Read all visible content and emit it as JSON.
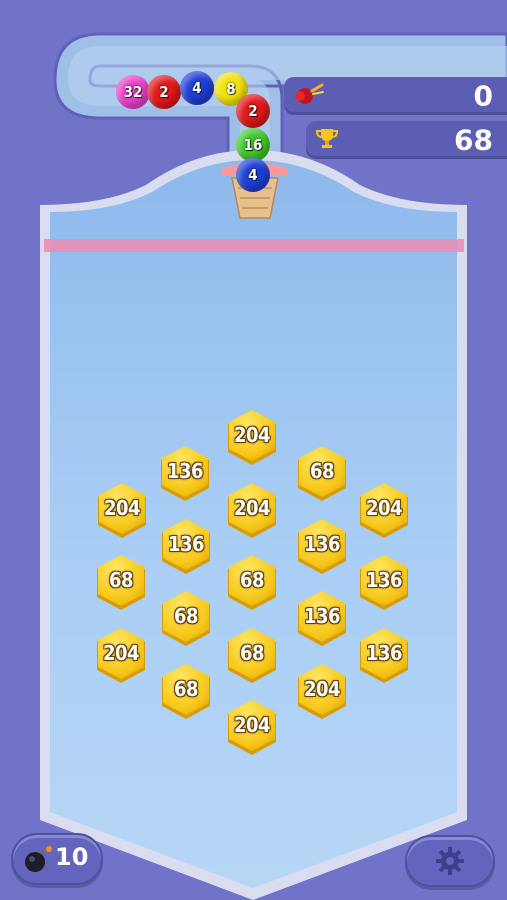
{
  "colors": {
    "background": "#7173c9",
    "board_fill": "#9fc7f4",
    "board_rim": "#d9ddef",
    "deadline": "#e88fb2",
    "hex_gold": "#f5c518",
    "panel": "#5b5eb2"
  },
  "hud": {
    "shots": {
      "icon": "cannon-icon",
      "value": "0"
    },
    "best": {
      "icon": "trophy-icon",
      "value": "68"
    }
  },
  "queue_balls": [
    {
      "label": "32",
      "color": "#e93fc9"
    },
    {
      "label": "2",
      "color": "#e01818"
    },
    {
      "label": "4",
      "color": "#1f3fd6"
    },
    {
      "label": "8",
      "color": "#f2e20a"
    },
    {
      "label": "2",
      "color": "#e01818"
    },
    {
      "label": "16",
      "color": "#3ec92c"
    }
  ],
  "current_ball": {
    "label": "4",
    "color": "#1f3fd6"
  },
  "hexes": [
    {
      "id": "hex-1",
      "label": "204"
    },
    {
      "id": "hex-2",
      "label": "136"
    },
    {
      "id": "hex-3",
      "label": "68"
    },
    {
      "id": "hex-4",
      "label": "204"
    },
    {
      "id": "hex-5",
      "label": "204"
    },
    {
      "id": "hex-6",
      "label": "204"
    },
    {
      "id": "hex-7",
      "label": "136"
    },
    {
      "id": "hex-8",
      "label": "136"
    },
    {
      "id": "hex-9",
      "label": "68"
    },
    {
      "id": "hex-10",
      "label": "68"
    },
    {
      "id": "hex-11",
      "label": "136"
    },
    {
      "id": "hex-12",
      "label": "68"
    },
    {
      "id": "hex-13",
      "label": "136"
    },
    {
      "id": "hex-14",
      "label": "204"
    },
    {
      "id": "hex-15",
      "label": "68"
    },
    {
      "id": "hex-16",
      "label": "136"
    },
    {
      "id": "hex-17",
      "label": "68"
    },
    {
      "id": "hex-18",
      "label": "204"
    },
    {
      "id": "hex-19",
      "label": "204"
    }
  ],
  "bottom": {
    "bomb": {
      "icon": "bomb-icon",
      "count": "10"
    },
    "settings": {
      "icon": "gear-icon"
    }
  }
}
